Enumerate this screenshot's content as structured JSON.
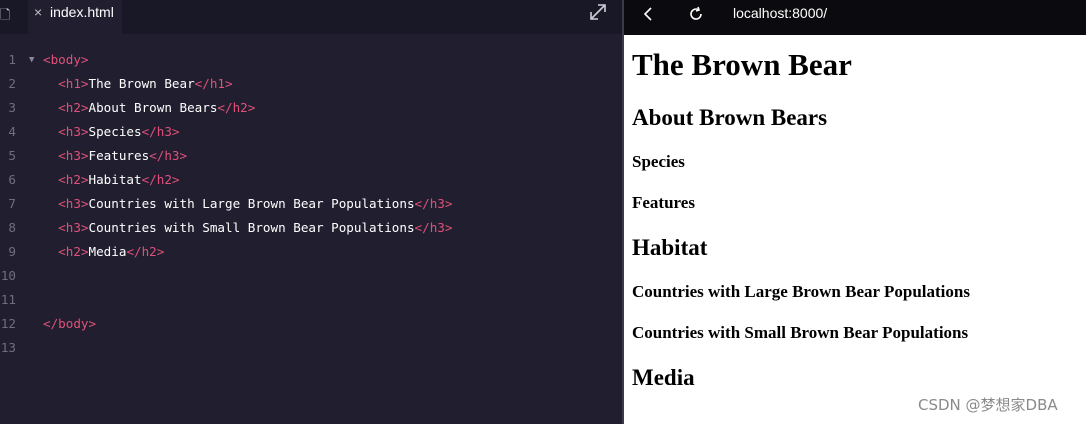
{
  "editor": {
    "tab": {
      "close_glyph": "×",
      "label": "index.html"
    },
    "icons": {
      "file": "file-icon",
      "expand": "expand-icon",
      "close": "close-icon",
      "fold": "fold-arrow-icon"
    },
    "lines": [
      {
        "num": "1",
        "open": "<body>",
        "text": "",
        "close": ""
      },
      {
        "num": "2",
        "open": "<h1>",
        "text": "The Brown Bear",
        "close": "</h1>"
      },
      {
        "num": "3",
        "open": "<h2>",
        "text": "About Brown Bears",
        "close": "</h2>"
      },
      {
        "num": "4",
        "open": "<h3>",
        "text": "Species",
        "close": "</h3>"
      },
      {
        "num": "5",
        "open": "<h3>",
        "text": "Features",
        "close": "</h3>"
      },
      {
        "num": "6",
        "open": "<h2>",
        "text": "Habitat",
        "close": "</h2>"
      },
      {
        "num": "7",
        "open": "<h3>",
        "text": "Countries with Large Brown Bear Populations",
        "close": "</h3>"
      },
      {
        "num": "8",
        "open": "<h3>",
        "text": "Countries with Small Brown Bear Populations",
        "close": "</h3>"
      },
      {
        "num": "9",
        "open": "<h2>",
        "text": "Media",
        "close": "</h2>"
      },
      {
        "num": "10",
        "open": "",
        "text": "",
        "close": ""
      },
      {
        "num": "11",
        "open": "",
        "text": "",
        "close": ""
      },
      {
        "num": "12",
        "open": "</body>",
        "text": "",
        "close": ""
      },
      {
        "num": "13",
        "open": "",
        "text": "",
        "close": ""
      }
    ]
  },
  "browser": {
    "url": "localhost:8000/",
    "icons": {
      "back": "back-arrow-icon",
      "refresh": "refresh-icon"
    },
    "page": {
      "h1": "The Brown Bear",
      "h2_about": "About Brown Bears",
      "h3_species": "Species",
      "h3_features": "Features",
      "h2_habitat": "Habitat",
      "h3_large": "Countries with Large Brown Bear Populations",
      "h3_small": "Countries with Small Brown Bear Populations",
      "h2_media": "Media"
    }
  },
  "colors": {
    "tag": "#e0507a",
    "editor_bg": "#211f2f",
    "urlbar_bg": "#0b0b0f"
  },
  "watermark": "CSDN @梦想家DBA"
}
